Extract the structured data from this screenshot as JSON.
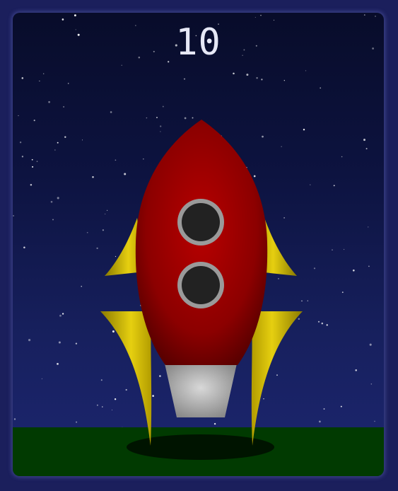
{
  "countdown": {
    "value": "10"
  },
  "colors": {
    "sky_top": "#080c2a",
    "sky_bottom": "#1c2670",
    "ground": "#013a01",
    "rocket_body": "#cc0000",
    "fins": "#e0c800",
    "porthole_ring": "#9a9a9a",
    "porthole_glass": "#222222",
    "nozzle": "#cfcfcf"
  },
  "icons": {
    "rocket": "rocket-icon",
    "portholes": [
      "porthole-icon",
      "porthole-icon"
    ]
  }
}
